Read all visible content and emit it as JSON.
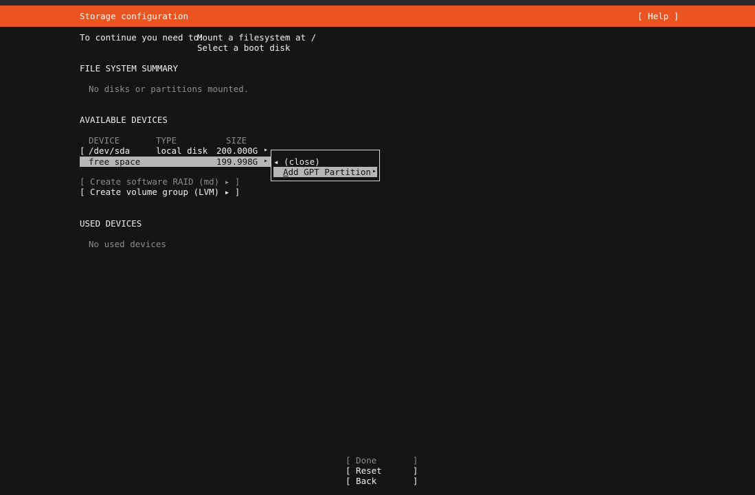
{
  "header": {
    "title": "Storage configuration",
    "help_label": "[ Help ]"
  },
  "requirements": {
    "prefix": "To continue you need to:",
    "items": [
      "Mount a filesystem at /",
      "Select a boot disk"
    ]
  },
  "fs_summary": {
    "heading": "FILE SYSTEM SUMMARY",
    "empty_text": "No disks or partitions mounted."
  },
  "available": {
    "heading": "AVAILABLE DEVICES",
    "columns": {
      "device": "DEVICE",
      "type": "TYPE",
      "size": "SIZE"
    },
    "rows": [
      {
        "bracket": "[",
        "device": "/dev/sda",
        "type": "local disk",
        "size": "200.000G",
        "arrow": "▸"
      },
      {
        "bracket": "",
        "device": "free space",
        "type": "",
        "size": "199.998G",
        "arrow": "▸"
      }
    ],
    "raid_label": "[ Create software RAID (md) ▸ ]",
    "lvm_label": "[ Create volume group (LVM) ▸ ]"
  },
  "popup_menu": {
    "close_label": "◂ (close)",
    "add_gpt_first": "A",
    "add_gpt_rest": "dd GPT Partition",
    "add_gpt_arrow": "▸"
  },
  "used": {
    "heading": "USED DEVICES",
    "empty_text": "No used devices"
  },
  "footer": {
    "done_label": "[ Done       ]",
    "reset_label": "[ Reset      ]",
    "back_label": "[ Back       ]"
  },
  "colors": {
    "accent": "#e95420",
    "background": "#151515",
    "highlight": "#b6b6b6"
  }
}
